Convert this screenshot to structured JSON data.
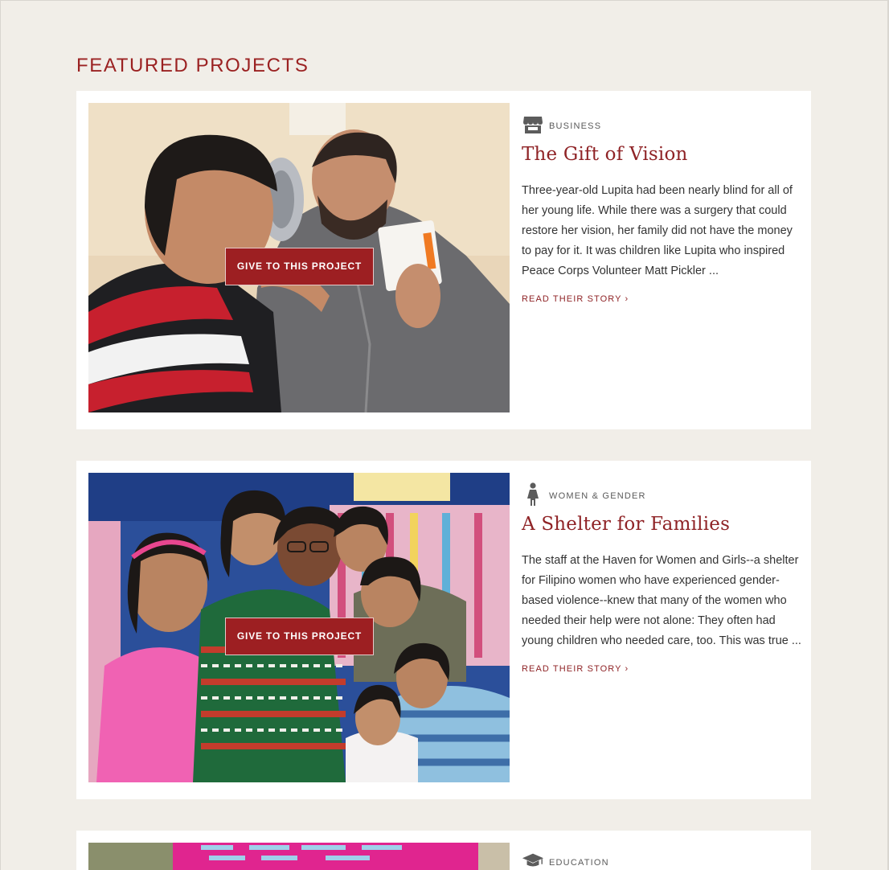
{
  "section": {
    "title": "FEATURED PROJECTS"
  },
  "projects": [
    {
      "category": "BUSINESS",
      "category_icon": "storefront-icon",
      "title": "The Gift of Vision",
      "excerpt": "Three-year-old Lupita had been nearly blind for all of her young life. While there was a surgery that could restore her vision, her family did not have the money to pay for it. It was children like Lupita who inspired Peace Corps Volunteer Matt Pickler ...",
      "give_label": "GIVE TO THIS PROJECT",
      "read_label": "READ THEIR STORY ›"
    },
    {
      "category": "WOMEN & GENDER",
      "category_icon": "woman-icon",
      "title": "A Shelter for Families",
      "excerpt": "The staff at the Haven for Women and Girls--a shelter for Filipino women who have experienced gender-based violence--knew that many of the women who needed their help were not alone: They often had young children who needed care, too. This was true ...",
      "give_label": "GIVE TO THIS PROJECT",
      "read_label": "READ THEIR STORY ›"
    },
    {
      "category": "EDUCATION",
      "category_icon": "graduation-cap-icon"
    }
  ],
  "colors": {
    "page_background": "#f1eee8",
    "accent": "#9b2222",
    "button": "#9d1f22",
    "card": "#ffffff"
  }
}
